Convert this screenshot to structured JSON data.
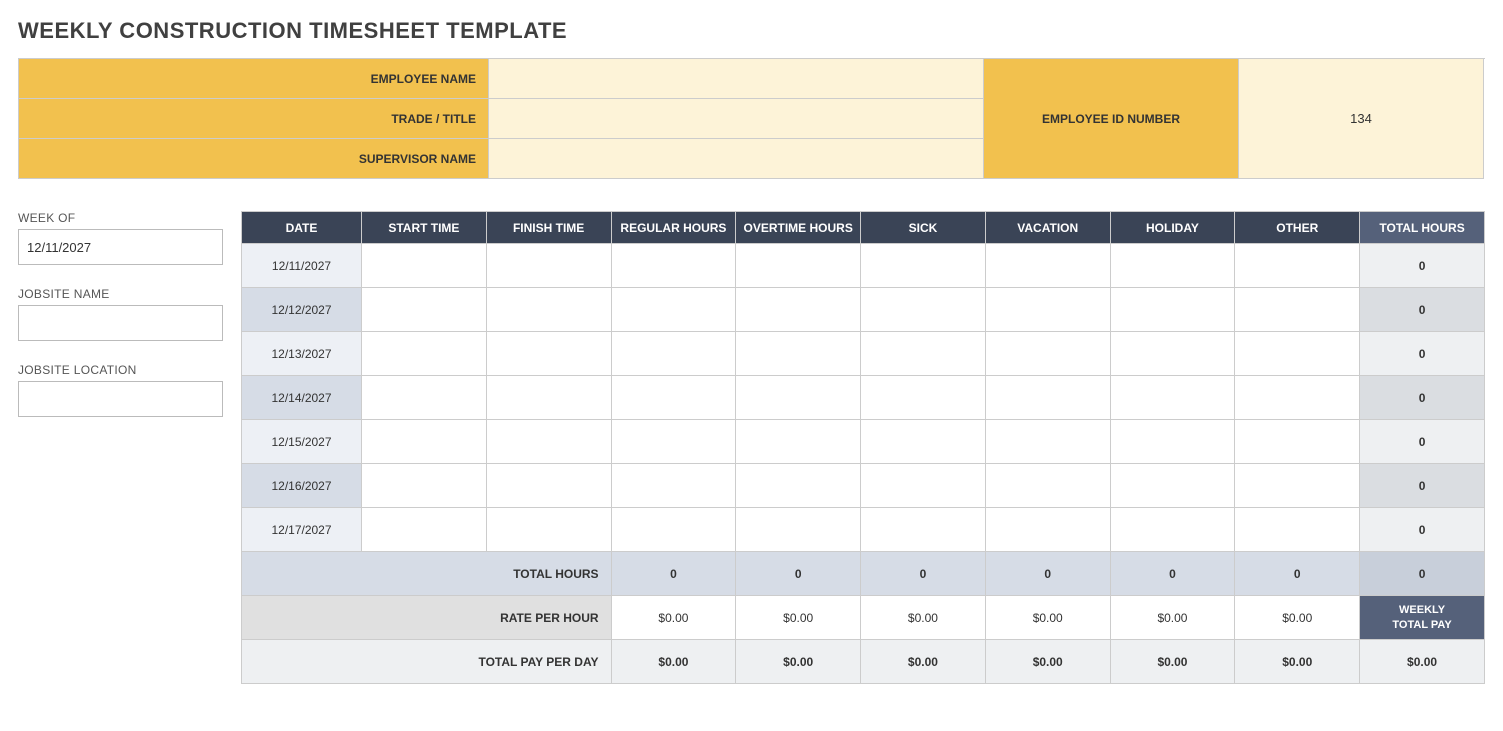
{
  "title": "WEEKLY CONSTRUCTION TIMESHEET TEMPLATE",
  "info": {
    "employee_name_label": "EMPLOYEE NAME",
    "employee_name_value": "",
    "trade_label": "TRADE / TITLE",
    "trade_value": "",
    "supervisor_label": "SUPERVISOR NAME",
    "supervisor_value": "",
    "employee_id_label": "EMPLOYEE ID NUMBER",
    "employee_id_value": "134"
  },
  "side": {
    "week_of_label": "WEEK OF",
    "week_of_value": "12/11/2027",
    "jobsite_name_label": "JOBSITE NAME",
    "jobsite_name_value": "",
    "jobsite_location_label": "JOBSITE LOCATION",
    "jobsite_location_value": ""
  },
  "headers": {
    "date": "DATE",
    "start": "START TIME",
    "finish": "FINISH TIME",
    "regular": "REGULAR HOURS",
    "overtime": "OVERTIME HOURS",
    "sick": "SICK",
    "vacation": "VACATION",
    "holiday": "HOLIDAY",
    "other": "OTHER",
    "total": "TOTAL HOURS"
  },
  "rows": [
    {
      "date": "12/11/2027",
      "start": "",
      "finish": "",
      "regular": "",
      "overtime": "",
      "sick": "",
      "vacation": "",
      "holiday": "",
      "other": "",
      "total": "0"
    },
    {
      "date": "12/12/2027",
      "start": "",
      "finish": "",
      "regular": "",
      "overtime": "",
      "sick": "",
      "vacation": "",
      "holiday": "",
      "other": "",
      "total": "0"
    },
    {
      "date": "12/13/2027",
      "start": "",
      "finish": "",
      "regular": "",
      "overtime": "",
      "sick": "",
      "vacation": "",
      "holiday": "",
      "other": "",
      "total": "0"
    },
    {
      "date": "12/14/2027",
      "start": "",
      "finish": "",
      "regular": "",
      "overtime": "",
      "sick": "",
      "vacation": "",
      "holiday": "",
      "other": "",
      "total": "0"
    },
    {
      "date": "12/15/2027",
      "start": "",
      "finish": "",
      "regular": "",
      "overtime": "",
      "sick": "",
      "vacation": "",
      "holiday": "",
      "other": "",
      "total": "0"
    },
    {
      "date": "12/16/2027",
      "start": "",
      "finish": "",
      "regular": "",
      "overtime": "",
      "sick": "",
      "vacation": "",
      "holiday": "",
      "other": "",
      "total": "0"
    },
    {
      "date": "12/17/2027",
      "start": "",
      "finish": "",
      "regular": "",
      "overtime": "",
      "sick": "",
      "vacation": "",
      "holiday": "",
      "other": "",
      "total": "0"
    }
  ],
  "summary": {
    "total_hours_label": "TOTAL HOURS",
    "total_hours": {
      "regular": "0",
      "overtime": "0",
      "sick": "0",
      "vacation": "0",
      "holiday": "0",
      "other": "0",
      "total": "0"
    },
    "rate_label": "RATE PER HOUR",
    "rates": {
      "regular": "$0.00",
      "overtime": "$0.00",
      "sick": "$0.00",
      "vacation": "$0.00",
      "holiday": "$0.00",
      "other": "$0.00"
    },
    "weekly_total_pay_label": "WEEKLY TOTAL PAY",
    "pay_label": "TOTAL PAY PER DAY",
    "pay": {
      "regular": "$0.00",
      "overtime": "$0.00",
      "sick": "$0.00",
      "vacation": "$0.00",
      "holiday": "$0.00",
      "other": "$0.00",
      "total": "$0.00"
    }
  }
}
